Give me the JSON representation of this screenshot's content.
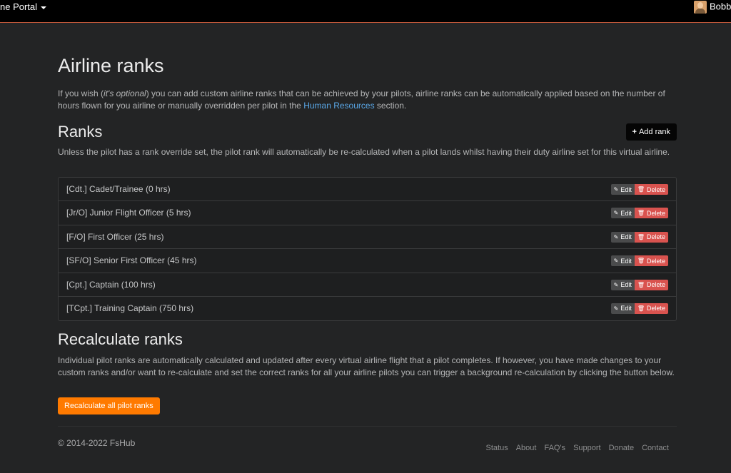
{
  "topbar": {
    "portal_label": "ne Portal",
    "user_name": "Bobby"
  },
  "page": {
    "title": "Airline ranks",
    "intro": {
      "part1": "If you wish (",
      "em": "it's optional",
      "part2": ") you can add custom airline ranks that can be achieved by your pilots, airline ranks can be automatically applied based on the number of hours flown for you airline or manually overridden per pilot in the ",
      "link": "Human Resources",
      "part3": " section."
    }
  },
  "ranks": {
    "title": "Ranks",
    "add_label": "Add rank",
    "description": "Unless the pilot has a rank override set, the pilot rank will automatically be re-calculated when a pilot lands whilst having their duty airline set for this virtual airline.",
    "edit_label": "Edit",
    "delete_label": "Delete",
    "items": [
      {
        "label": "[Cdt.] Cadet/Trainee (0 hrs)"
      },
      {
        "label": "[Jr/O] Junior Flight Officer (5 hrs)"
      },
      {
        "label": "[F/O] First Officer (25 hrs)"
      },
      {
        "label": "[SF/O] Senior First Officer (45 hrs)"
      },
      {
        "label": "[Cpt.] Captain (100 hrs)"
      },
      {
        "label": "[TCpt.] Training Captain (750 hrs)"
      }
    ]
  },
  "recalculate": {
    "title": "Recalculate ranks",
    "description": "Individual pilot ranks are automatically calculated and updated after every virtual airline flight that a pilot completes. If however, you have made changes to your custom ranks and/or want to re-calculate and set the correct ranks for all your airline pilots you can trigger a background re-calculation by clicking the button below.",
    "button_label": "Recalculate all pilot ranks"
  },
  "footer": {
    "copyright": "© 2014-2022 FsHub",
    "links": [
      "Status",
      "About",
      "FAQ's",
      "Support",
      "Donate",
      "Contact"
    ]
  },
  "colors": {
    "background": "#232425",
    "accent": "#ff7a00",
    "delete": "#d9534f",
    "link": "#5aa8e8"
  }
}
